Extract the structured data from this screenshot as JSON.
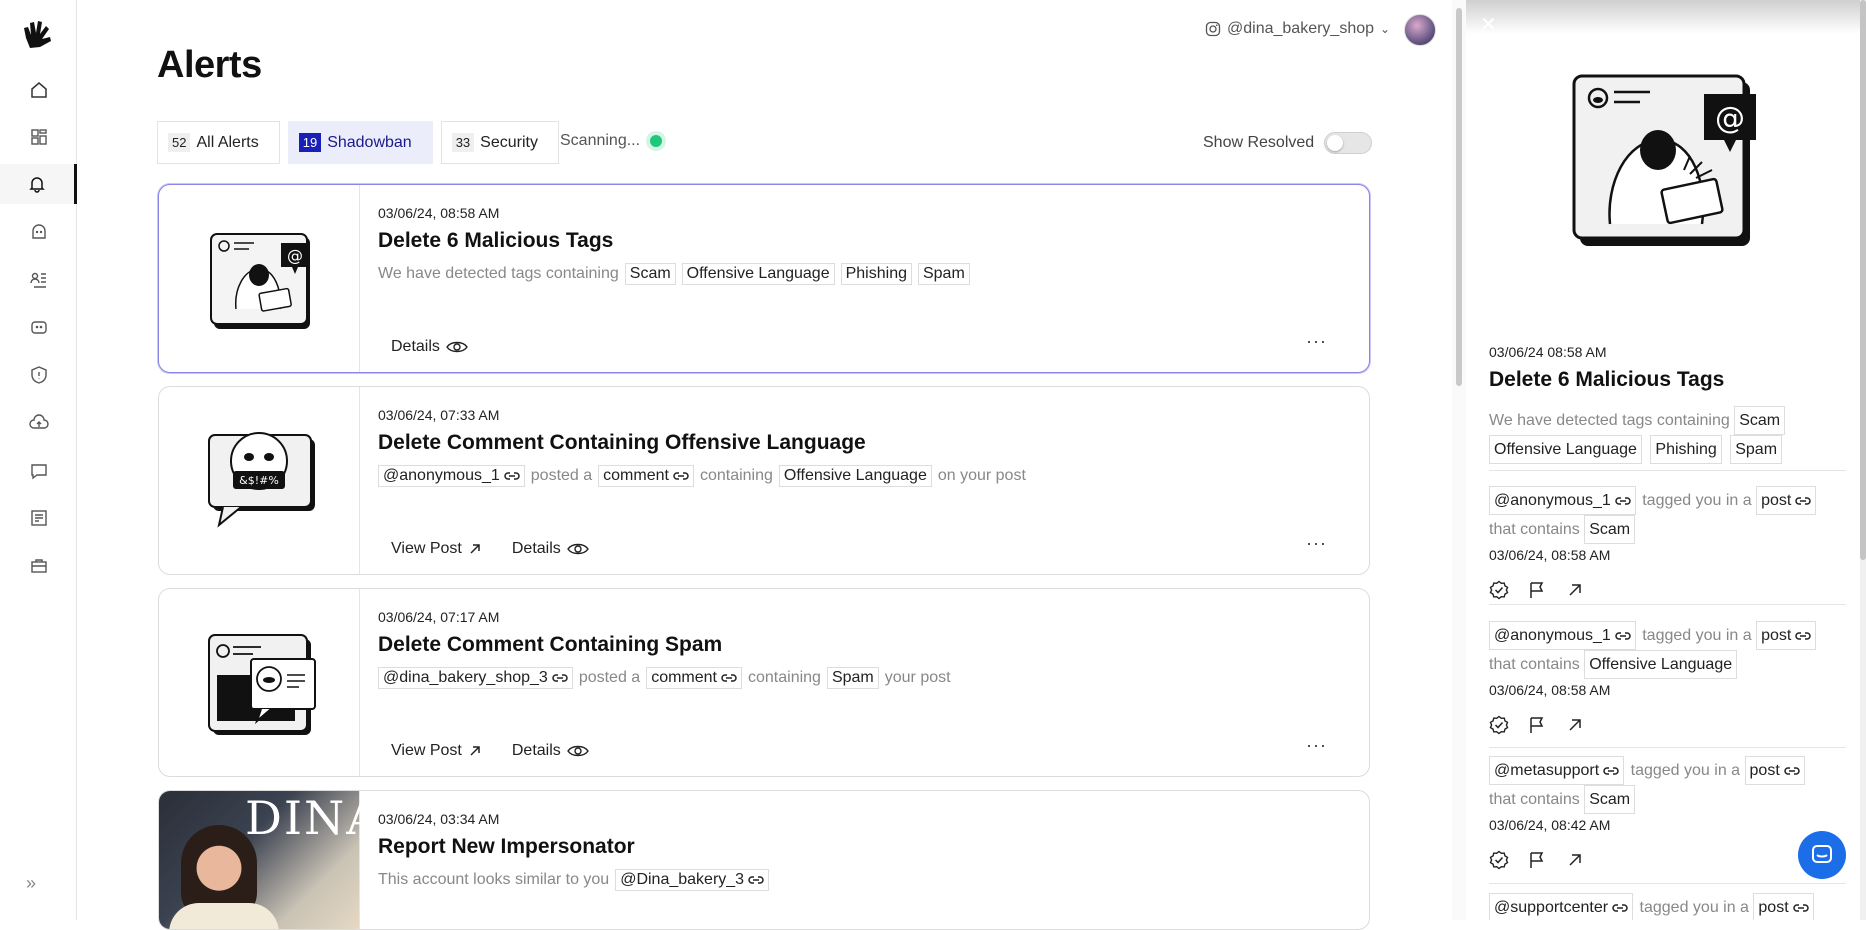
{
  "account": {
    "handle": "@dina_bakery_shop"
  },
  "page": {
    "title": "Alerts"
  },
  "tabs": [
    {
      "count": "52",
      "label": "All Alerts"
    },
    {
      "count": "19",
      "label": "Shadowban"
    },
    {
      "count": "33",
      "label": "Security"
    }
  ],
  "scanning": "Scanning...",
  "show_resolved": "Show Resolved",
  "cards": [
    {
      "date": "03/06/24, 08:58 AM",
      "title": "Delete 6 Malicious Tags",
      "desc_prefix": "We have detected tags containing",
      "tags": [
        "Scam",
        "Offensive Language",
        "Phishing",
        "Spam"
      ],
      "details": "Details"
    },
    {
      "date": "03/06/24, 07:33 AM",
      "title": "Delete Comment Containing Offensive Language",
      "user": "@anonymous_1",
      "posted_a": "posted a",
      "object": "comment",
      "containing": "containing",
      "tag": "Offensive Language",
      "suffix": "on your post",
      "view_post": "View Post",
      "details": "Details"
    },
    {
      "date": "03/06/24, 07:17 AM",
      "title": "Delete Comment Containing Spam",
      "user": "@dina_bakery_shop_3",
      "posted_a": "posted a",
      "object": "comment",
      "containing": "containing",
      "tag": "Spam",
      "suffix": "your post",
      "view_post": "View Post",
      "details": "Details"
    },
    {
      "date": "03/06/24, 03:34 AM",
      "title": "Report New Impersonator",
      "desc_prefix": "This account looks similar to you",
      "user": "@Dina_bakery_3",
      "photo_text": "DINA"
    }
  ],
  "panel": {
    "date": "03/06/24 08:58 AM",
    "title": "Delete 6 Malicious Tags",
    "desc_prefix": "We have detected tags containing",
    "tags": [
      "Scam",
      "Offensive Language",
      "Phishing",
      "Spam"
    ],
    "items": [
      {
        "user": "@anonymous_1",
        "tagged": "tagged you in a",
        "object": "post",
        "contains": "that contains",
        "tag": "Scam",
        "date": "03/06/24, 08:58 AM"
      },
      {
        "user": "@anonymous_1",
        "tagged": "tagged you in a",
        "object": "post",
        "contains": "that contains",
        "tag": "Offensive Language",
        "date": "03/06/24, 08:58 AM"
      },
      {
        "user": "@metasupport",
        "tagged": "tagged you in a",
        "object": "post",
        "contains": "that contains",
        "tag": "Scam",
        "date": "03/06/24, 08:42 AM"
      },
      {
        "user": "@supportcenter",
        "tagged": "tagged you in a",
        "object": "post"
      }
    ]
  }
}
